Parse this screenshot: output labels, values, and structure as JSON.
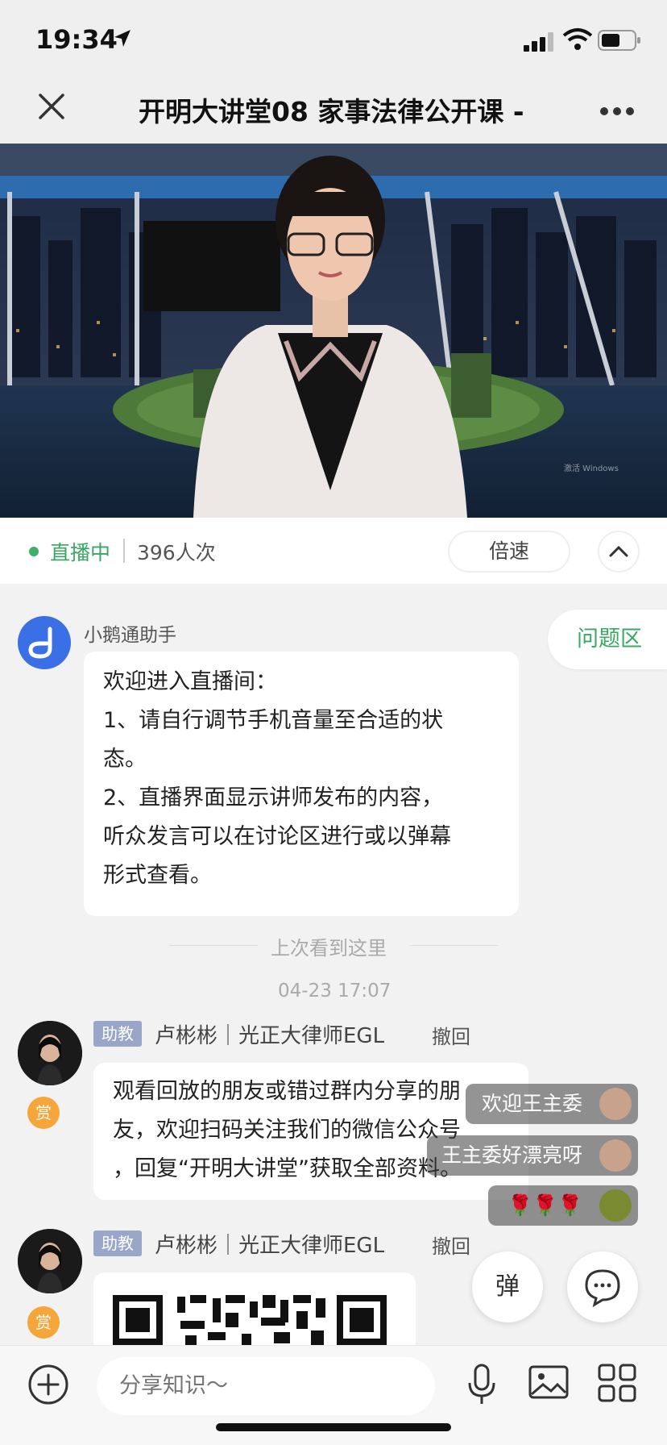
{
  "status_bar": {
    "time": "19:34"
  },
  "nav": {
    "title": "开明大讲堂08 家事法律公开课 -"
  },
  "live": {
    "status": "直播中",
    "viewers": "396人次",
    "speed_label": "倍速"
  },
  "qa_button": "问题区",
  "assistant_msg": {
    "sender": "小鹅通助手",
    "lines": [
      "欢迎进入直播间：",
      "1、请自行调节手机音量至合适的状",
      "态。",
      "2、直播界面显示讲师发布的内容，",
      "听众发言可以在讨论区进行或以弹幕",
      "形式查看。"
    ]
  },
  "divider": "上次看到这里",
  "timestamp": "04-23 17:07",
  "messages": [
    {
      "role": "助教",
      "sender": "卢彬彬｜光正大律师EGL",
      "revoke": "撤回",
      "reward": "赏",
      "lines": [
        "观看回放的朋友或错过群内分享的朋",
        "友，欢迎扫码关注我们的微信公众号",
        "，回复“开明大讲堂”获取全部资料。"
      ]
    },
    {
      "role": "助教",
      "sender": "卢彬彬｜光正大律师EGL",
      "revoke": "撤回",
      "reward": "赏"
    }
  ],
  "danmaku": [
    "欢迎王主委",
    "王主委好漂亮呀",
    "🌹🌹🌹"
  ],
  "float_buttons": {
    "barrage": "弹"
  },
  "input": {
    "placeholder": "分享知识～"
  },
  "video": {
    "watermark": "激活 Windows"
  }
}
